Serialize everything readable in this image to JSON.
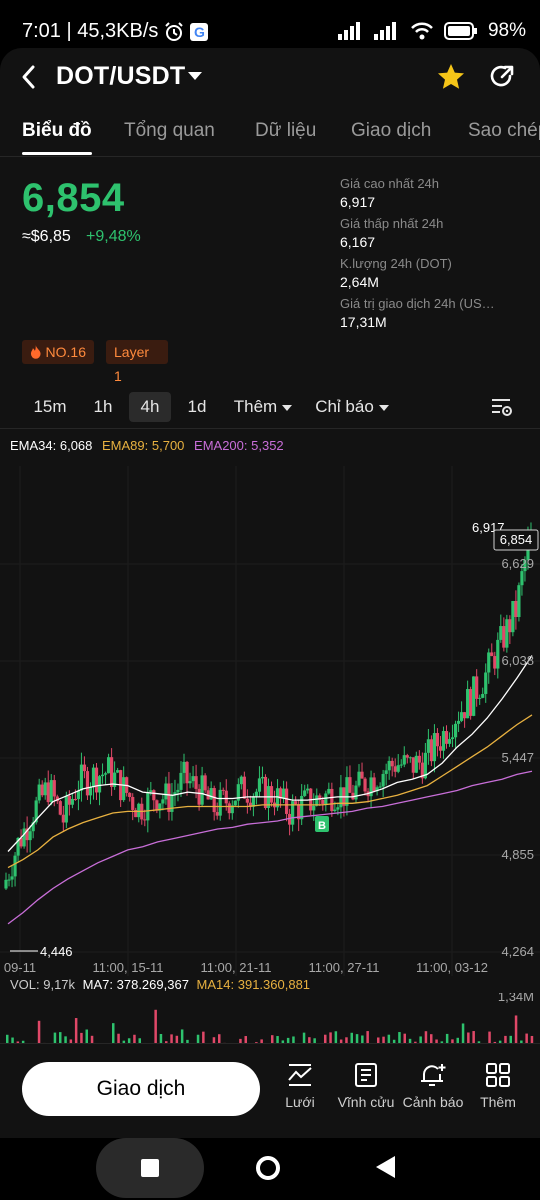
{
  "status_bar": {
    "time_speed": "7:01 | 45,3KB/s",
    "battery": "98%"
  },
  "header": {
    "pair": "DOT/USDT"
  },
  "tabs": [
    "Biểu đồ",
    "Tổng quan",
    "Dữ liệu",
    "Giao dịch",
    "Sao chép"
  ],
  "ticker": {
    "price": "6,854",
    "fiat": "≈$6,85",
    "change": "+9,48%"
  },
  "stats": [
    {
      "label": "Giá cao nhất 24h",
      "value": "6,917"
    },
    {
      "label": "Giá thấp nhất 24h",
      "value": "6,167"
    },
    {
      "label": "K.lượng 24h (DOT)",
      "value": "2,64M"
    },
    {
      "label": "Giá trị giao dịch 24h (US…",
      "value": "17,31M"
    }
  ],
  "badges": {
    "rank": "NO.16",
    "tag": "Layer 1"
  },
  "intervals": {
    "items": [
      "15m",
      "1h",
      "4h",
      "1d"
    ],
    "active": "4h",
    "more": "Thêm",
    "indicators": "Chỉ báo"
  },
  "ema": {
    "ema34": "EMA34: 6,068",
    "ema89": "EMA89: 5,700",
    "ema200": "EMA200: 5,352"
  },
  "volume_labels": {
    "vol": "VOL: 9,17k",
    "ma7": "MA7: 378.269,367",
    "ma14": "MA14: 391.360,881",
    "axis_max": "1,34M"
  },
  "colors": {
    "up": "#2ec26e",
    "down": "#e04868",
    "ema34": "#ffffff",
    "ema89": "#e8b140",
    "ema200": "#c86ed8",
    "accent_star": "#f5c518"
  },
  "chart_data": {
    "type": "candlestick",
    "y_ticks": [
      "6,629",
      "6,038",
      "5,447",
      "4,855",
      "4,264"
    ],
    "x_ticks": [
      "09-11",
      "11:00, 15-11",
      "11:00, 21-11",
      "11:00, 27-11",
      "11:00, 03-12"
    ],
    "high_marker": "6,917",
    "low_marker": "4,446",
    "last_price_tag": "6,854",
    "buy_marker": "B",
    "close_series": [
      4.62,
      4.9,
      5.1,
      5.25,
      5.05,
      5.28,
      5.32,
      5.35,
      5.24,
      5.12,
      5.2,
      5.18,
      5.3,
      5.24,
      5.12,
      5.18,
      5.24,
      5.22,
      5.2,
      5.1,
      5.15,
      5.18,
      5.22,
      5.2,
      5.28,
      5.34,
      5.4,
      5.38,
      5.42,
      5.55,
      5.7,
      5.8,
      5.95,
      6.15,
      6.35,
      6.85
    ],
    "ema34_series": [
      4.85,
      4.95,
      5.06,
      5.16,
      5.2,
      5.24,
      5.26,
      5.27,
      5.26,
      5.22,
      5.21,
      5.2,
      5.22,
      5.21,
      5.18,
      5.18,
      5.19,
      5.19,
      5.19,
      5.17,
      5.17,
      5.18,
      5.19,
      5.19,
      5.21,
      5.24,
      5.28,
      5.3,
      5.33,
      5.4,
      5.5,
      5.58,
      5.68,
      5.8,
      5.93,
      6.07
    ],
    "ema89_series": [
      4.75,
      4.8,
      4.86,
      4.94,
      4.99,
      5.03,
      5.06,
      5.09,
      5.1,
      5.1,
      5.11,
      5.12,
      5.13,
      5.13,
      5.13,
      5.13,
      5.13,
      5.14,
      5.14,
      5.14,
      5.14,
      5.14,
      5.15,
      5.15,
      5.16,
      5.18,
      5.2,
      5.23,
      5.26,
      5.32,
      5.38,
      5.44,
      5.5,
      5.57,
      5.64,
      5.7
    ],
    "ema200_series": [
      4.4,
      4.47,
      4.55,
      4.62,
      4.68,
      4.73,
      4.78,
      4.82,
      4.86,
      4.88,
      4.91,
      4.93,
      4.95,
      4.97,
      4.99,
      5.0,
      5.02,
      5.03,
      5.04,
      5.06,
      5.07,
      5.08,
      5.09,
      5.1,
      5.12,
      5.13,
      5.15,
      5.17,
      5.19,
      5.21,
      5.23,
      5.26,
      5.28,
      5.3,
      5.33,
      5.35
    ]
  },
  "bottom_bar": {
    "trade_label": "Giao dịch",
    "actions": [
      "Lưới",
      "Vĩnh cửu",
      "Cảnh báo",
      "Thêm"
    ]
  }
}
